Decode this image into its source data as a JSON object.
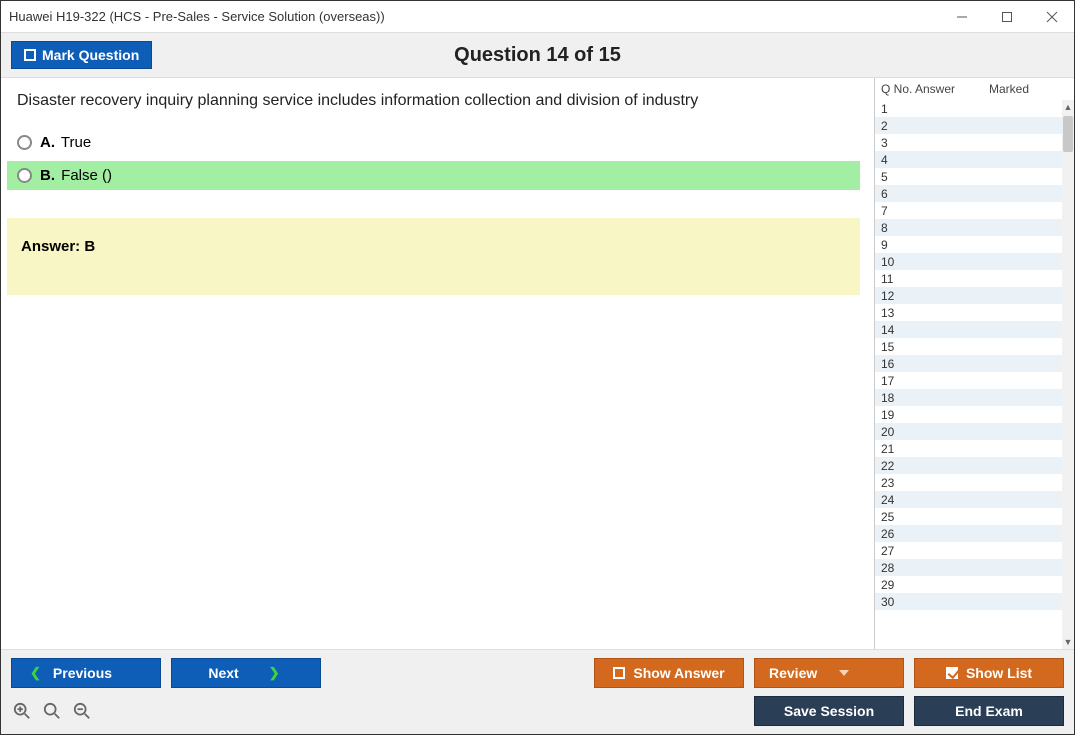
{
  "window": {
    "title": "Huawei H19-322 (HCS - Pre-Sales - Service Solution (overseas))"
  },
  "header": {
    "mark_label": "Mark Question",
    "question_counter": "Question 14 of 15"
  },
  "question": {
    "text": "Disaster recovery inquiry planning service includes information collection and division of industry",
    "option_a_letter": "A.",
    "option_a_text": "True",
    "option_b_letter": "B.",
    "option_b_text": "False ()",
    "answer_label": "Answer: B"
  },
  "sidebar": {
    "col_qno": "Q No.",
    "col_answer": "Answer",
    "col_marked": "Marked",
    "rows": [
      "1",
      "2",
      "3",
      "4",
      "5",
      "6",
      "7",
      "8",
      "9",
      "10",
      "11",
      "12",
      "13",
      "14",
      "15",
      "16",
      "17",
      "18",
      "19",
      "20",
      "21",
      "22",
      "23",
      "24",
      "25",
      "26",
      "27",
      "28",
      "29",
      "30"
    ]
  },
  "footer": {
    "previous": "Previous",
    "next": "Next",
    "show_answer": "Show Answer",
    "review": "Review",
    "show_list": "Show List",
    "save_session": "Save Session",
    "end_exam": "End Exam"
  }
}
